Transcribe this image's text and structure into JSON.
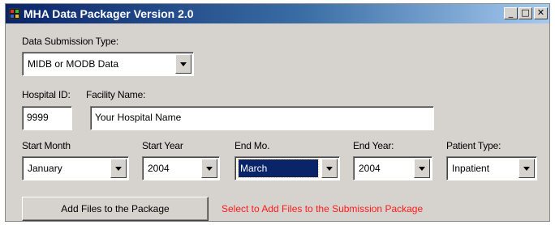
{
  "window": {
    "title": "MHA Data Packager Version 2.0",
    "controls": {
      "minimize": "_",
      "maximize": "□",
      "close": "✕"
    }
  },
  "submission_type": {
    "label": "Data Submission Type:",
    "value": "MIDB or MODB Data"
  },
  "hospital_id": {
    "label": "Hospital ID:",
    "value": "9999"
  },
  "facility_name": {
    "label": "Facility Name:",
    "value": "Your Hospital Name"
  },
  "start_month": {
    "label": "Start Month",
    "value": "January"
  },
  "start_year": {
    "label": "Start Year",
    "value": "2004"
  },
  "end_month": {
    "label": "End Mo.",
    "value": "March"
  },
  "end_year": {
    "label": "End Year:",
    "value": "2004"
  },
  "patient_type": {
    "label": "Patient Type:",
    "value": "Inpatient"
  },
  "add_files": {
    "button_label": "Add Files to the Package",
    "hint": "Select to Add Files to the Submission Package"
  },
  "colors": {
    "title_bar": "#0a246a",
    "hint_text": "#ff1a1a",
    "selection": "#0a246a",
    "window_bg": "#d6d3ce"
  }
}
